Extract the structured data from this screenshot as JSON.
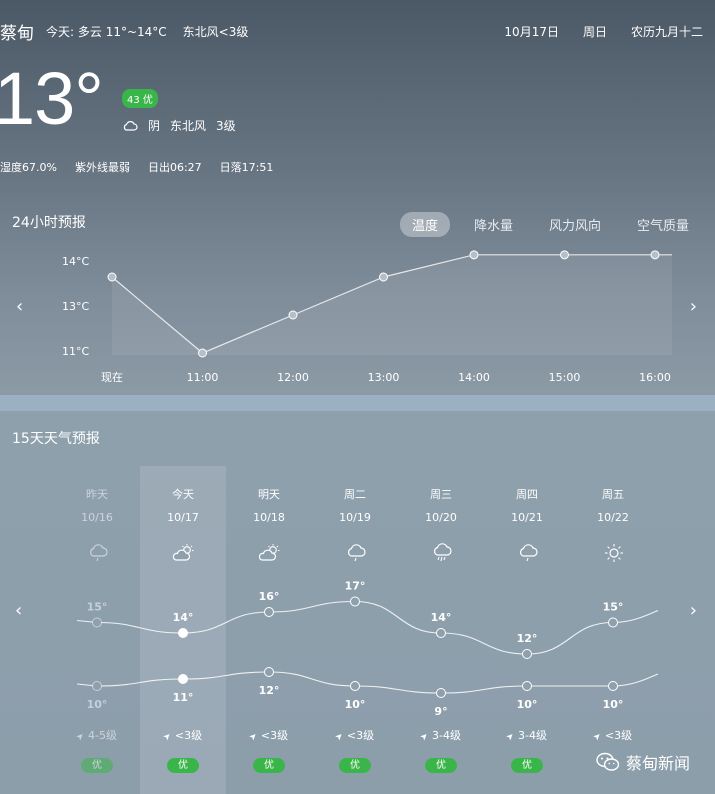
{
  "header": {
    "city": "蔡甸",
    "today_brief": "今天:",
    "today_cond": "多云 11°~14°C",
    "today_wind": "东北风<3级",
    "date": "10月17日",
    "weekday": "周日",
    "lunar": "农历九月十二"
  },
  "current": {
    "temp": "13°",
    "aqi": "43 优",
    "weather": "阴",
    "wind_dir": "东北风",
    "wind_level": "3级",
    "humidity": "湿度67.0%",
    "uv": "紫外线最弱",
    "sunrise": "日出06:27",
    "sunset": "日落17:51"
  },
  "hourly": {
    "title": "24小时预报",
    "tabs": [
      "温度",
      "降水量",
      "风力风向",
      "空气质量"
    ],
    "active_tab": 0
  },
  "chart_data": {
    "type": "line",
    "categories": [
      "现在",
      "11:00",
      "12:00",
      "13:00",
      "14:00",
      "15:00",
      "16:00"
    ],
    "values": [
      13.4,
      11,
      12.2,
      13.4,
      14.1,
      14.1,
      14.1
    ],
    "ytick_labels": [
      "14°C",
      "13°C",
      "11°C"
    ],
    "ylim": [
      11,
      14
    ]
  },
  "daily": {
    "title": "15天天气预报",
    "days": [
      {
        "name": "昨天",
        "date": "10/16",
        "icon": "rain-cloud-icon",
        "high": "15°",
        "low": "10°",
        "wind": "4-5级",
        "aq": "优"
      },
      {
        "name": "今天",
        "date": "10/17",
        "icon": "partly-cloudy-icon",
        "high": "14°",
        "low": "11°",
        "wind": "<3级",
        "aq": "优"
      },
      {
        "name": "明天",
        "date": "10/18",
        "icon": "partly-cloudy-icon",
        "high": "16°",
        "low": "12°",
        "wind": "<3级",
        "aq": "优"
      },
      {
        "name": "周二",
        "date": "10/19",
        "icon": "rain-cloud-icon",
        "high": "17°",
        "low": "10°",
        "wind": "<3级",
        "aq": "优"
      },
      {
        "name": "周三",
        "date": "10/20",
        "icon": "heavy-rain-icon",
        "high": "14°",
        "low": "9°",
        "wind": "3-4级",
        "aq": "优"
      },
      {
        "name": "周四",
        "date": "10/21",
        "icon": "rain-cloud-icon",
        "high": "12°",
        "low": "10°",
        "wind": "3-4级",
        "aq": "优"
      },
      {
        "name": "周五",
        "date": "10/22",
        "icon": "sun-icon",
        "high": "15°",
        "low": "10°",
        "wind": "<3级",
        "aq": null
      }
    ],
    "highs": [
      15,
      14,
      16,
      17,
      14,
      12,
      15
    ],
    "lows": [
      10,
      11,
      12,
      10,
      9,
      10,
      10
    ]
  },
  "footer": {
    "brand": "蔡甸新闻"
  },
  "colors": {
    "accent_green": "#3ab54a"
  }
}
